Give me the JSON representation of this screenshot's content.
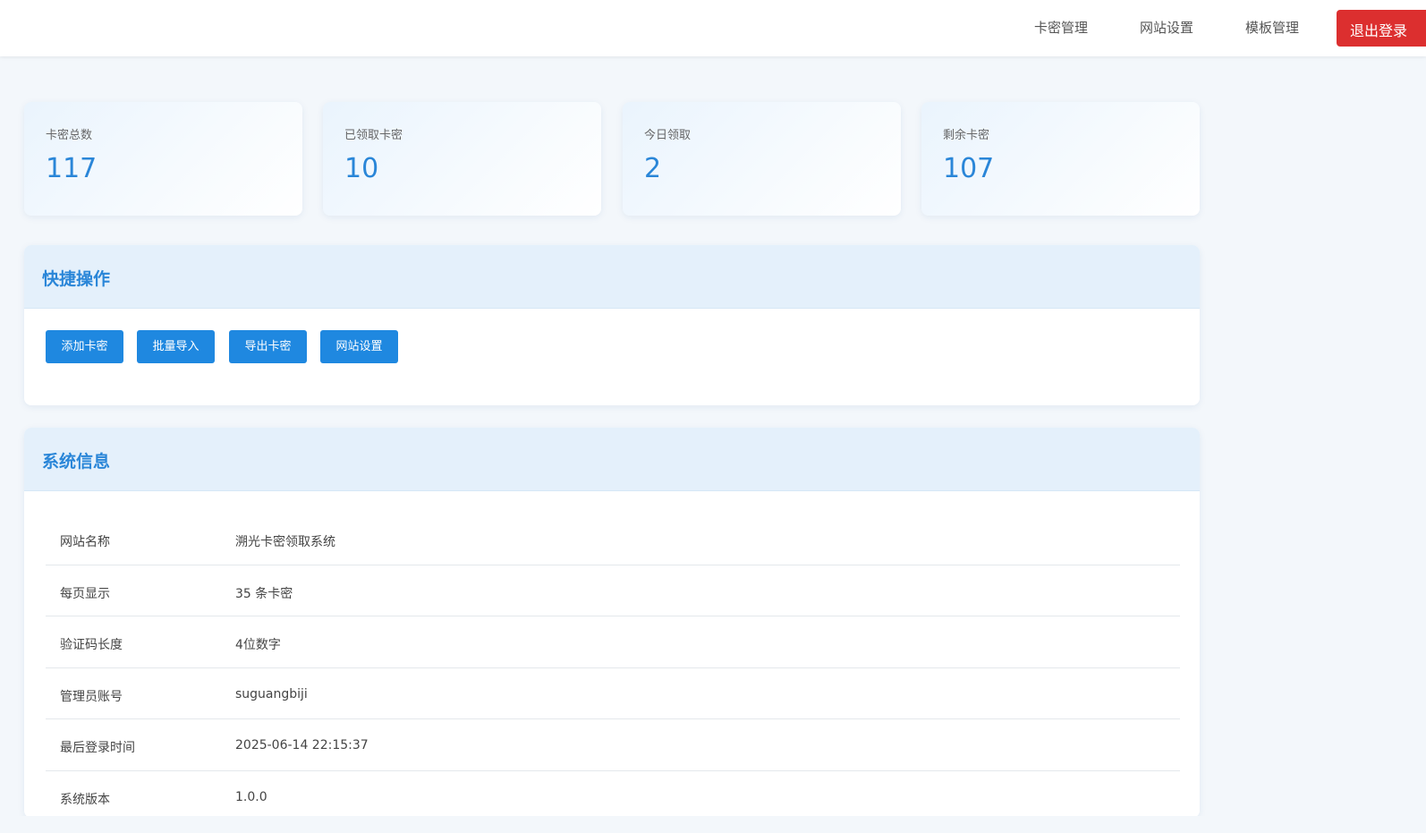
{
  "nav": {
    "items": [
      "卡密管理",
      "网站设置",
      "模板管理"
    ],
    "logout_label": "退出登录"
  },
  "stats": [
    {
      "label": "卡密总数",
      "value": "117"
    },
    {
      "label": "已领取卡密",
      "value": "10"
    },
    {
      "label": "今日领取",
      "value": "2"
    },
    {
      "label": "剩余卡密",
      "value": "107"
    }
  ],
  "quick_actions": {
    "title": "快捷操作",
    "buttons": [
      "添加卡密",
      "批量导入",
      "导出卡密",
      "网站设置"
    ]
  },
  "system_info": {
    "title": "系统信息",
    "rows": [
      {
        "key": "网站名称",
        "value": "溯光卡密领取系统"
      },
      {
        "key": "每页显示",
        "value": "35 条卡密"
      },
      {
        "key": "验证码长度",
        "value": "4位数字"
      },
      {
        "key": "管理员账号",
        "value": "suguangbiji"
      },
      {
        "key": "最后登录时间",
        "value": "2025-06-14 22:15:37"
      },
      {
        "key": "系统版本",
        "value": "1.0.0"
      }
    ]
  },
  "colors": {
    "accent": "#2a86d8",
    "button": "#1f88e0",
    "danger": "#dc2f2f",
    "panel_header": "#e4f0fb",
    "page_bg": "#f3f7fb"
  }
}
